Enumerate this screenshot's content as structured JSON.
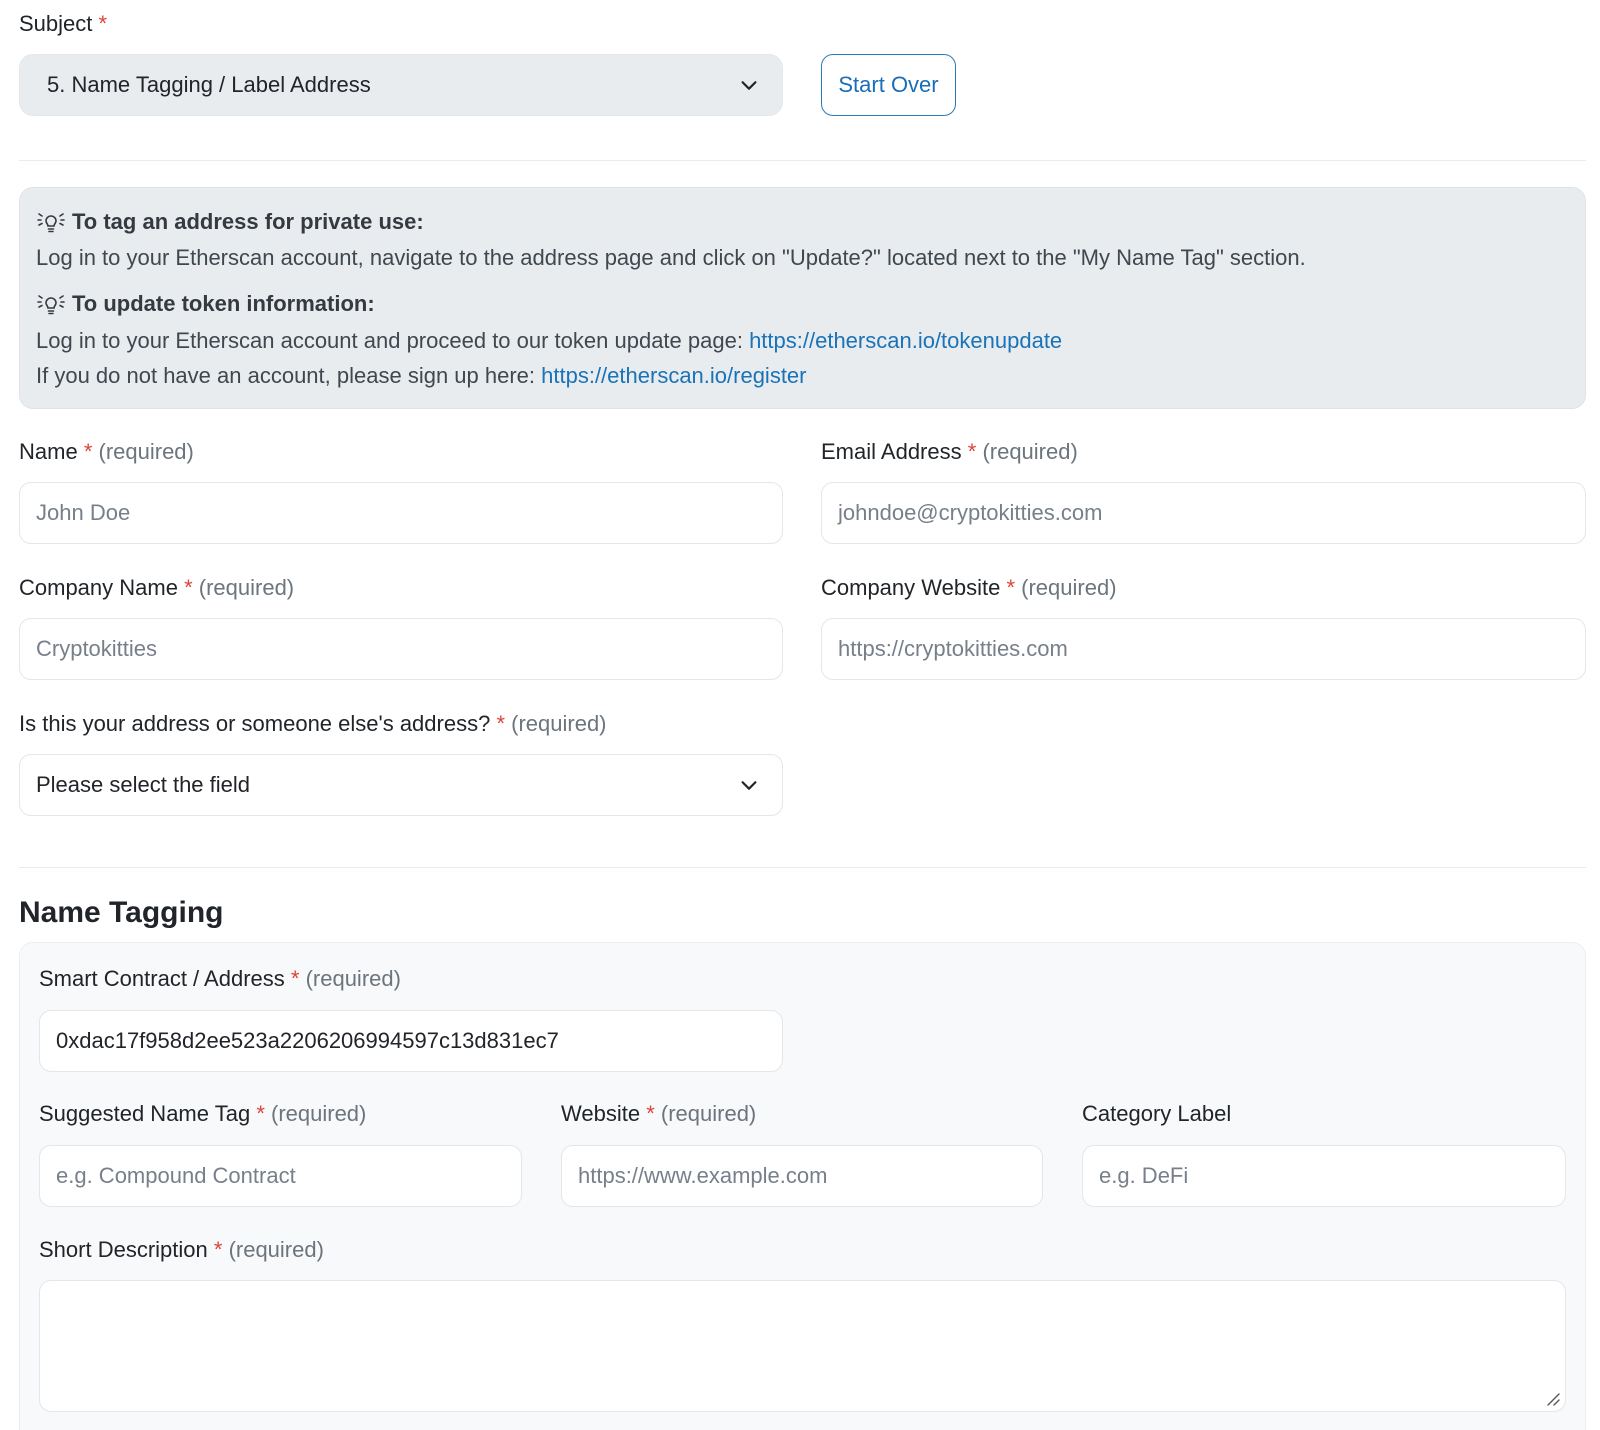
{
  "subject": {
    "label": "Subject",
    "star": "*",
    "selected": "5. Name Tagging / Label Address",
    "start_over_label": "Start Over"
  },
  "info": {
    "private_title": "To tag an address for private use:",
    "private_text": "Log in to your Etherscan account, navigate to the address page and click on \"Update?\" located next to the \"My Name Tag\" section.",
    "token_title": "To update token information:",
    "token_text": "Log in to your Etherscan account and proceed to our token update page: ",
    "token_link": "https://etherscan.io/tokenupdate",
    "register_text": "If you do not have an account, please sign up here: ",
    "register_link": "https://etherscan.io/register"
  },
  "required_text": "(required)",
  "contact": {
    "name_label": "Name",
    "name_placeholder": "John Doe",
    "email_label": "Email Address",
    "email_placeholder": "johndoe@cryptokitties.com",
    "company_label": "Company Name",
    "company_placeholder": "Cryptokitties",
    "website_label": "Company Website",
    "website_placeholder": "https://cryptokitties.com",
    "ownership_label": "Is this your address or someone else's address?",
    "ownership_selected": "Please select the field"
  },
  "name_tagging": {
    "title": "Name Tagging",
    "address_label": "Smart Contract / Address",
    "address_value": "0xdac17f958d2ee523a2206206994597c13d831ec7",
    "tag_label": "Suggested Name Tag",
    "tag_placeholder": "e.g. Compound Contract",
    "site_label": "Website",
    "site_placeholder": "https://www.example.com",
    "category_label": "Category Label",
    "category_placeholder": "e.g. DeFi",
    "description_label": "Short Description"
  },
  "icons": {
    "info": "lightbulb-icon",
    "chevron": "chevron-down-icon",
    "resize": "resize-handle-icon"
  },
  "colors": {
    "accent": "#1a73b7",
    "required_star": "#de4437",
    "info_bg": "#e9ecef"
  }
}
